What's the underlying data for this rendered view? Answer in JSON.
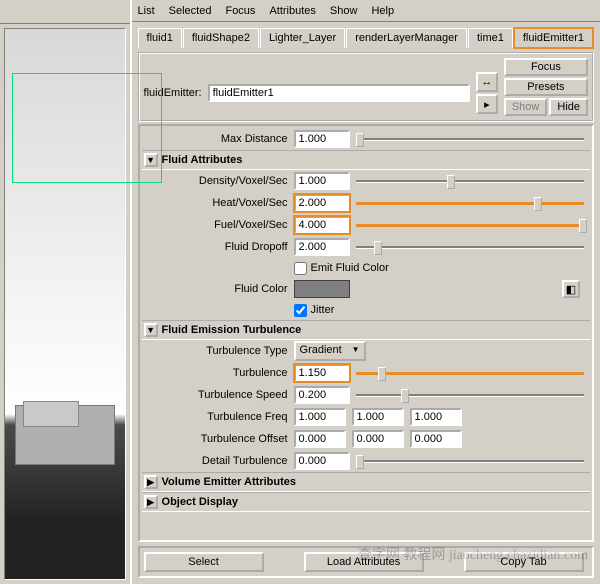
{
  "menu": {
    "list": "List",
    "selected": "Selected",
    "focus": "Focus",
    "attributes": "Attributes",
    "show": "Show",
    "help": "Help"
  },
  "tabs": [
    "fluid1",
    "fluidShape2",
    "Lighter_Layer",
    "renderLayerManager",
    "time1",
    "fluidEmitter1"
  ],
  "header": {
    "type_label": "fluidEmitter:",
    "name_value": "fluidEmitter1",
    "focus_btn": "Focus",
    "presets_btn": "Presets",
    "show_btn": "Show",
    "hide_btn": "Hide"
  },
  "max_dist": {
    "label": "Max Distance",
    "value": "1.000"
  },
  "sections": {
    "fluid_attrs": "Fluid Attributes",
    "emission_turb": "Fluid Emission Turbulence",
    "volume_emitter": "Volume Emitter Attributes",
    "object_display": "Object Display"
  },
  "fa": {
    "dens_label": "Density/Voxel/Sec",
    "dens_val": "1.000",
    "heat_label": "Heat/Voxel/Sec",
    "heat_val": "2.000",
    "fuel_label": "Fuel/Voxel/Sec",
    "fuel_val": "4.000",
    "drop_label": "Fluid Dropoff",
    "drop_val": "2.000",
    "emit_color": "Emit Fluid Color",
    "color_label": "Fluid Color",
    "jitter": "Jitter"
  },
  "turb": {
    "type_label": "Turbulence Type",
    "type_val": "Gradient",
    "turb_label": "Turbulence",
    "turb_val": "1.150",
    "speed_label": "Turbulence Speed",
    "speed_val": "0.200",
    "freq_label": "Turbulence Freq",
    "freq_x": "1.000",
    "freq_y": "1.000",
    "freq_z": "1.000",
    "offset_label": "Turbulence Offset",
    "off_x": "0.000",
    "off_y": "0.000",
    "off_z": "0.000",
    "detail_label": "Detail Turbulence",
    "detail_val": "0.000"
  },
  "footer": {
    "select": "Select",
    "load": "Load Attributes",
    "copy": "Copy Tab"
  },
  "watermark": "查字网 教程网\njiaocheng.chazidian.com"
}
